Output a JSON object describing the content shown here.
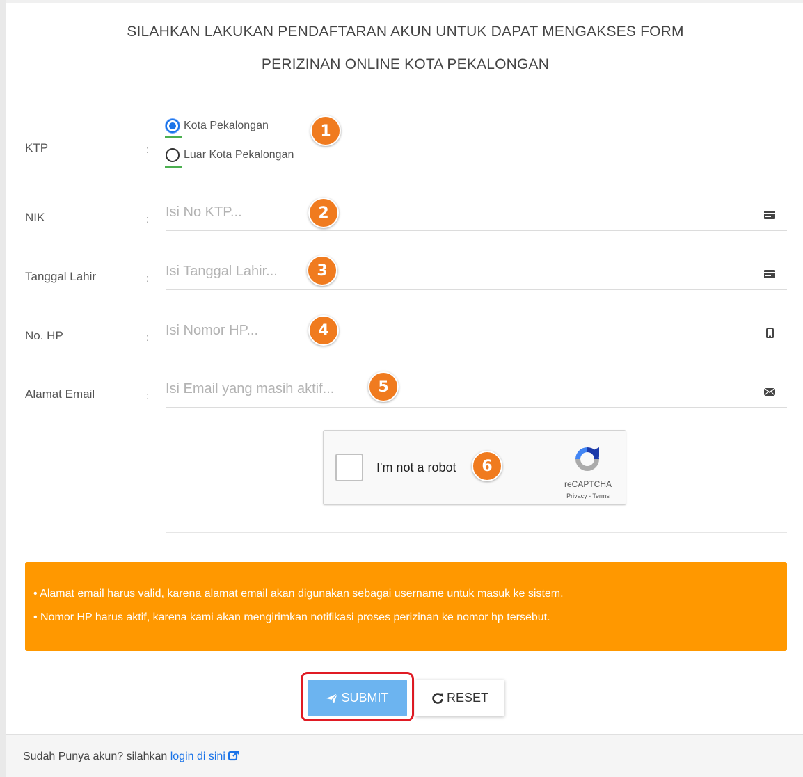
{
  "header": {
    "title_line1": "SILAHKAN LAKUKAN PENDAFTARAN AKUN UNTUK DAPAT MENGAKSES FORM",
    "title_line2": "PERIZINAN ONLINE KOTA PEKALONGAN"
  },
  "form": {
    "colon": ":",
    "ktp": {
      "label": "KTP",
      "options": [
        {
          "label": "Kota Pekalongan",
          "selected": true
        },
        {
          "label": "Luar Kota Pekalongan",
          "selected": false
        }
      ]
    },
    "nik": {
      "label": "NIK",
      "placeholder": "Isi No KTP...",
      "icon": "id-card-icon"
    },
    "tanggal_lahir": {
      "label": "Tanggal Lahir",
      "placeholder": "Isi Tanggal Lahir...",
      "icon": "id-card-icon"
    },
    "no_hp": {
      "label": "No. HP",
      "placeholder": "Isi Nomor HP...",
      "icon": "mobile-phone-icon"
    },
    "email": {
      "label": "Alamat Email",
      "placeholder": "Isi Email yang masih aktif...",
      "icon": "envelope-icon"
    }
  },
  "captcha": {
    "text": "I'm not a robot",
    "brand": "reCAPTCHA",
    "links": "Privacy - Terms"
  },
  "annotations": [
    "1",
    "2",
    "3",
    "4",
    "5",
    "6"
  ],
  "alert": {
    "lines": [
      "• Alamat email harus valid, karena alamat email akan digunakan sebagai username untuk masuk ke sistem.",
      "• Nomor HP harus aktif, karena kami akan mengirimkan notifikasi proses perizinan ke nomor hp tersebut."
    ]
  },
  "buttons": {
    "submit_label": "SUBMIT",
    "reset_label": "RESET"
  },
  "footer": {
    "text": "Sudah Punya akun? silahkan",
    "link": "login di sini"
  },
  "colors": {
    "accent": "#1a73e8",
    "alert": "#ff9800",
    "submit": "#6cb4f0",
    "badge": "#f07b1f",
    "highlight": "#e01b24"
  }
}
